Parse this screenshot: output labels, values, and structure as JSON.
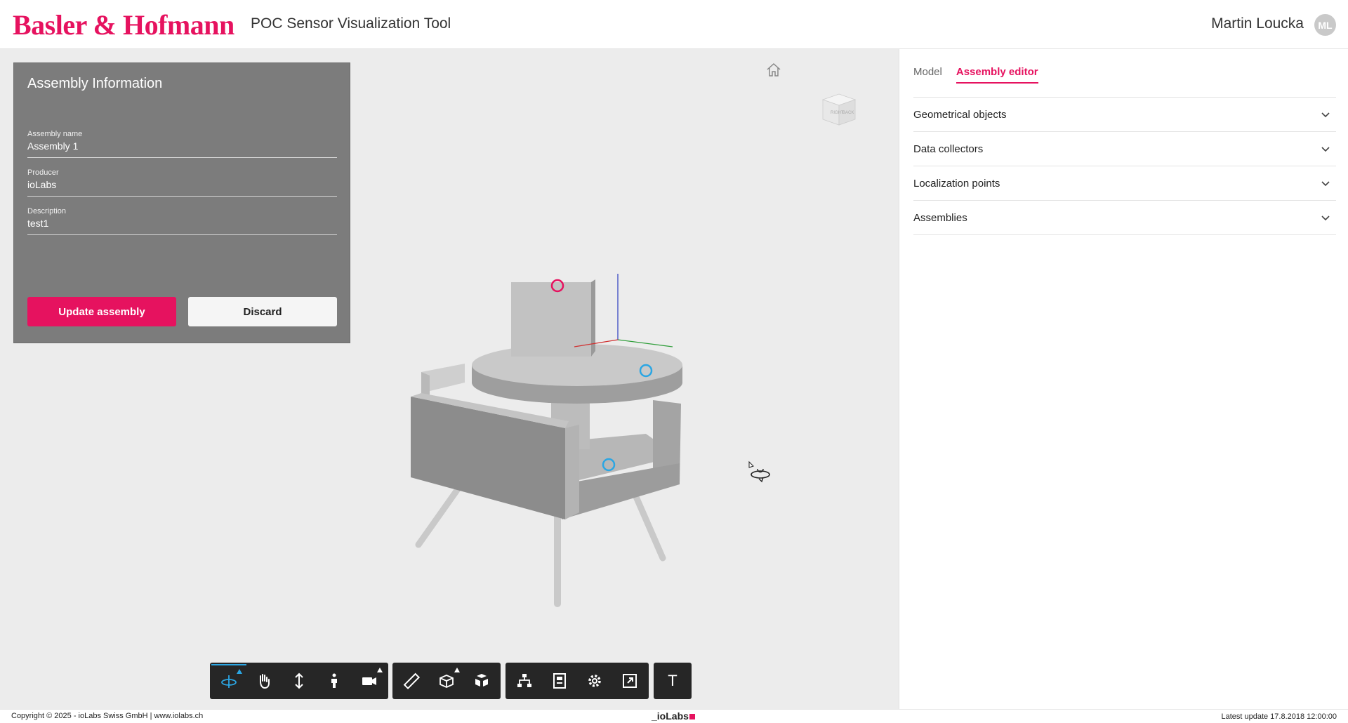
{
  "header": {
    "logo_text": "Basler & Hofmann",
    "app_title": "POC Sensor Visualization Tool",
    "user_name": "Martin Loucka",
    "user_initials": "ML"
  },
  "assembly_panel": {
    "title": "Assembly Information",
    "fields": [
      {
        "label": "Assembly name",
        "value": "Assembly 1"
      },
      {
        "label": "Producer",
        "value": "ioLabs"
      },
      {
        "label": "Description",
        "value": "test1"
      }
    ],
    "update_label": "Update assembly",
    "discard_label": "Discard"
  },
  "view_cube": {
    "right": "RIGHT",
    "back": "BACK"
  },
  "toolbar": {
    "groups": [
      [
        "orbit-icon",
        "pan-icon",
        "zoom-icon",
        "first-person-icon",
        "camera-icon"
      ],
      [
        "measure-icon",
        "section-icon",
        "explode-icon"
      ],
      [
        "model-browser-icon",
        "properties-icon",
        "settings-icon",
        "fullscreen-icon"
      ],
      [
        "text-icon"
      ]
    ],
    "text_tool_label": "T"
  },
  "right_panel": {
    "tabs": [
      {
        "label": "Model",
        "active": false
      },
      {
        "label": "Assembly editor",
        "active": true
      }
    ],
    "accordion": [
      "Geometrical objects",
      "Data collectors",
      "Localization points",
      "Assemblies"
    ]
  },
  "footer": {
    "copyright": "Copyright © 2025 - ioLabs Swiss GmbH | www.iolabs.ch",
    "logo": "_ioLabs",
    "last_update": "Latest update 17.8.2018 12:00:00"
  },
  "colors": {
    "brand": "#e6125f",
    "sensor_blue": "#2ba6e3",
    "panel_gray": "#7c7c7c",
    "toolbar_dark": "#262626"
  }
}
